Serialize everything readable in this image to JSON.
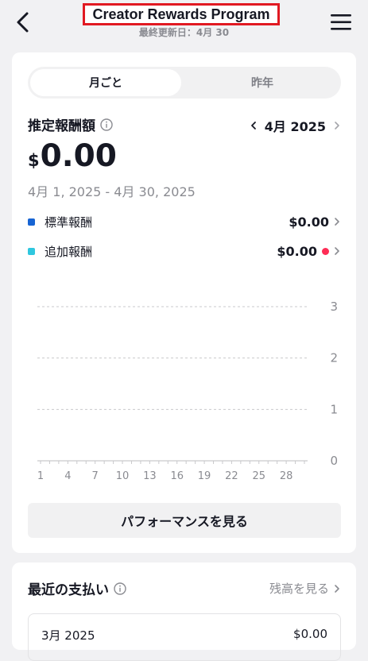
{
  "header": {
    "title": "Creator Rewards Program",
    "updated": "最終更新日：4月 30"
  },
  "tabs": {
    "monthly": "月ごと",
    "last_year": "昨年"
  },
  "estimate": {
    "heading": "推定報酬額",
    "month_label": "4月 2025",
    "currency": "$",
    "amount": "0.00",
    "range": "4月 1, 2025 - 4月 30, 2025"
  },
  "breakdown": [
    {
      "label": "標準報酬",
      "value": "$0.00",
      "color": "#1764d3"
    },
    {
      "label": "追加報酬",
      "value": "$0.00",
      "color": "#2fc7df"
    }
  ],
  "chart_data": {
    "type": "bar",
    "x_ticks": [
      "1",
      "4",
      "7",
      "10",
      "13",
      "16",
      "19",
      "22",
      "25",
      "28"
    ],
    "y_ticks": [
      "0",
      "1",
      "2",
      "3"
    ],
    "ylim": [
      0,
      3
    ],
    "values": [],
    "grid": true
  },
  "performance_button": "パフォーマンスを見る",
  "recent_payments": {
    "heading": "最近の支払い",
    "balance_link": "残高を見る",
    "rows": [
      {
        "month": "3月 2025",
        "amount": "$0.00"
      }
    ]
  },
  "colors": {
    "accent_red": "#fe2c55",
    "title_border": "#e11922"
  }
}
